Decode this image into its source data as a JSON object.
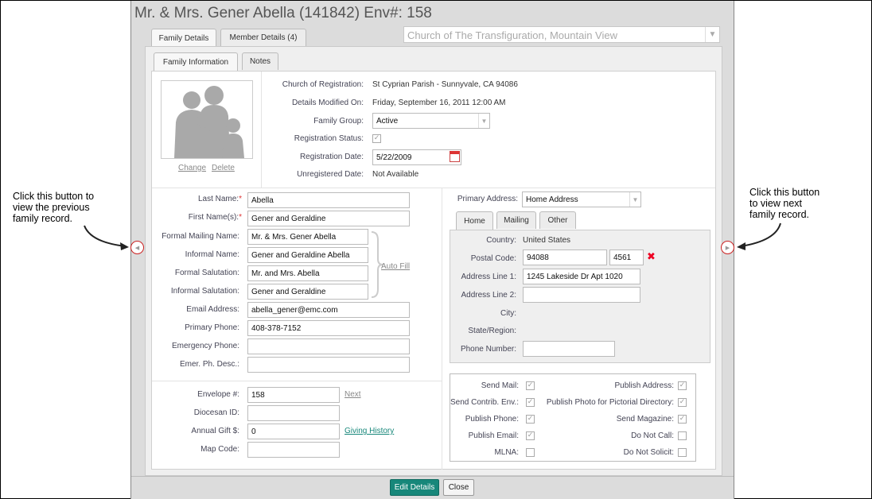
{
  "header": {
    "title": "Mr. & Mrs. Gener Abella (141842) Env#: 158"
  },
  "tabs": [
    {
      "label": "Family Details"
    },
    {
      "label": "Member Details (4)"
    }
  ],
  "church_select": {
    "value": "Church of The Transfiguration, Mountain View"
  },
  "subtabs": [
    {
      "label": "Family Information"
    },
    {
      "label": "Notes"
    }
  ],
  "photo": {
    "change": "Change",
    "delete": "Delete"
  },
  "info": {
    "church_reg_label": "Church of Registration:",
    "church_reg_value": "St Cyprian Parish - Sunnyvale, CA 94086",
    "modified_label": "Details Modified On:",
    "modified_value": "Friday, September 16, 2011 12:00 AM",
    "group_label": "Family Group:",
    "group_value": "Active",
    "reg_status_label": "Registration Status:",
    "reg_date_label": "Registration Date:",
    "reg_date_value": "5/22/2009",
    "unreg_label": "Unregistered Date:",
    "unreg_value": "Not Available"
  },
  "names": {
    "last_label": "Last Name:",
    "last_value": "Abella",
    "first_label": "First Name(s):",
    "first_value": "Gener and Geraldine",
    "formal_mail_label": "Formal Mailing Name:",
    "formal_mail_value": "Mr. & Mrs. Gener Abella",
    "informal_name_label": "Informal Name:",
    "informal_name_value": "Gener and Geraldine Abella",
    "formal_sal_label": "Formal Salutation:",
    "formal_sal_value": "Mr. and Mrs. Abella",
    "informal_sal_label": "Informal Salutation:",
    "informal_sal_value": "Gener and Geraldine",
    "autofill": "Auto Fill",
    "email_label": "Email Address:",
    "email_value": "abella_gener@emc.com",
    "phone_label": "Primary Phone:",
    "phone_value": "408-378-7152",
    "emerg_label": "Emergency Phone:",
    "emerg_value": "",
    "emerg_desc_label": "Emer. Ph. Desc.:",
    "emerg_desc_value": ""
  },
  "envelope": {
    "env_label": "Envelope #:",
    "env_value": "158",
    "next": "Next",
    "diocesan_label": "Diocesan ID:",
    "diocesan_value": "",
    "gift_label": "Annual Gift $:",
    "gift_value": "0",
    "giving_history": "Giving History",
    "map_label": "Map Code:",
    "map_value": ""
  },
  "address": {
    "primary_label": "Primary Address:",
    "primary_value": "Home Address",
    "tabs": [
      {
        "label": "Home"
      },
      {
        "label": "Mailing"
      },
      {
        "label": "Other"
      }
    ],
    "country_label": "Country:",
    "country_value": "United States",
    "postal_label": "Postal Code:",
    "postal_value": "94088",
    "postal_ext": "4561",
    "line1_label": "Address Line 1:",
    "line1_value": "1245 Lakeside Dr Apt 1020",
    "line2_label": "Address Line 2:",
    "line2_value": "",
    "city_label": "City:",
    "state_label": "State/Region:",
    "phone_label": "Phone Number:",
    "phone_value": ""
  },
  "prefs": {
    "send_mail": "Send Mail:",
    "send_contrib": "Send Contrib. Env.:",
    "publish_phone": "Publish Phone:",
    "publish_email": "Publish Email:",
    "mlna": "MLNA:",
    "publish_address": "Publish Address:",
    "publish_photo": "Publish Photo for Pictorial Directory:",
    "send_magazine": "Send Magazine:",
    "do_not_call": "Do Not Call:",
    "do_not_solicit": "Do Not Solicit:"
  },
  "buttons": {
    "edit": "Edit Details",
    "close": "Close"
  },
  "annotations": {
    "left": [
      "Click this button to",
      "view the previous",
      "family record."
    ],
    "right": [
      "Click this button",
      "to view next",
      "family record."
    ]
  },
  "colors": {
    "accent": "#17877a",
    "required": "#dd3333",
    "nav_ring": "#cc2222"
  }
}
